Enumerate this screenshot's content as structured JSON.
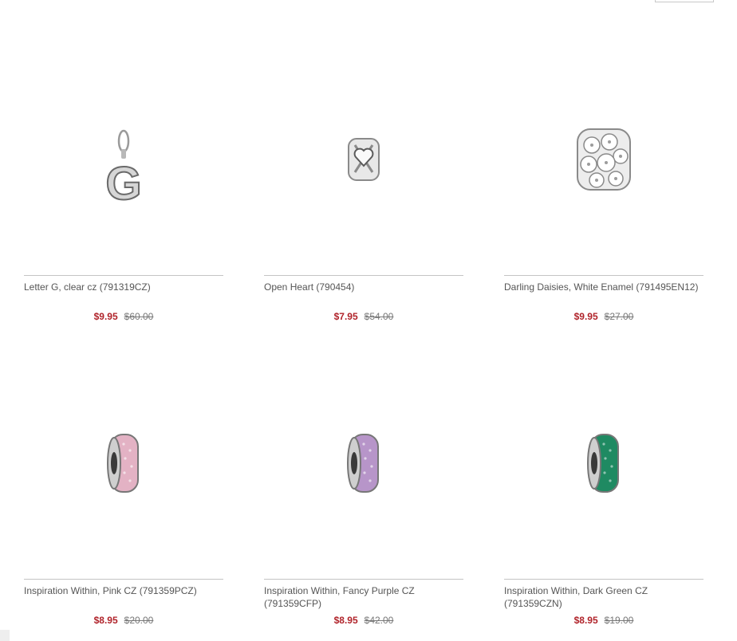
{
  "products": [
    {
      "name": "Letter G, clear cz (791319CZ)",
      "sale_price": "$9.95",
      "original_price": "$60.00",
      "image_icon": "letter-g-pendant-icon"
    },
    {
      "name": "Open Heart (790454)",
      "sale_price": "$7.95",
      "original_price": "$54.00",
      "image_icon": "open-heart-charm-icon"
    },
    {
      "name": "Darling Daisies, White Enamel (791495EN12)",
      "sale_price": "$9.95",
      "original_price": "$27.00",
      "image_icon": "daisy-spacer-charm-icon"
    },
    {
      "name": "Inspiration Within, Pink CZ (791359PCZ)",
      "sale_price": "$8.95",
      "original_price": "$20.00",
      "image_icon": "pink-pave-spacer-icon",
      "stone_color": "#e3b2c4"
    },
    {
      "name": "Inspiration Within, Fancy Purple CZ (791359CFP)",
      "sale_price": "$8.95",
      "original_price": "$42.00",
      "image_icon": "purple-pave-spacer-icon",
      "stone_color": "#b795c9"
    },
    {
      "name": "Inspiration Within, Dark Green CZ (791359CZN)",
      "sale_price": "$8.95",
      "original_price": "$19.00",
      "image_icon": "green-pave-spacer-icon",
      "stone_color": "#1f8a62"
    }
  ],
  "colors": {
    "sale_price": "#b0232a",
    "original_price": "#777777",
    "divider": "#c4c4c4"
  }
}
